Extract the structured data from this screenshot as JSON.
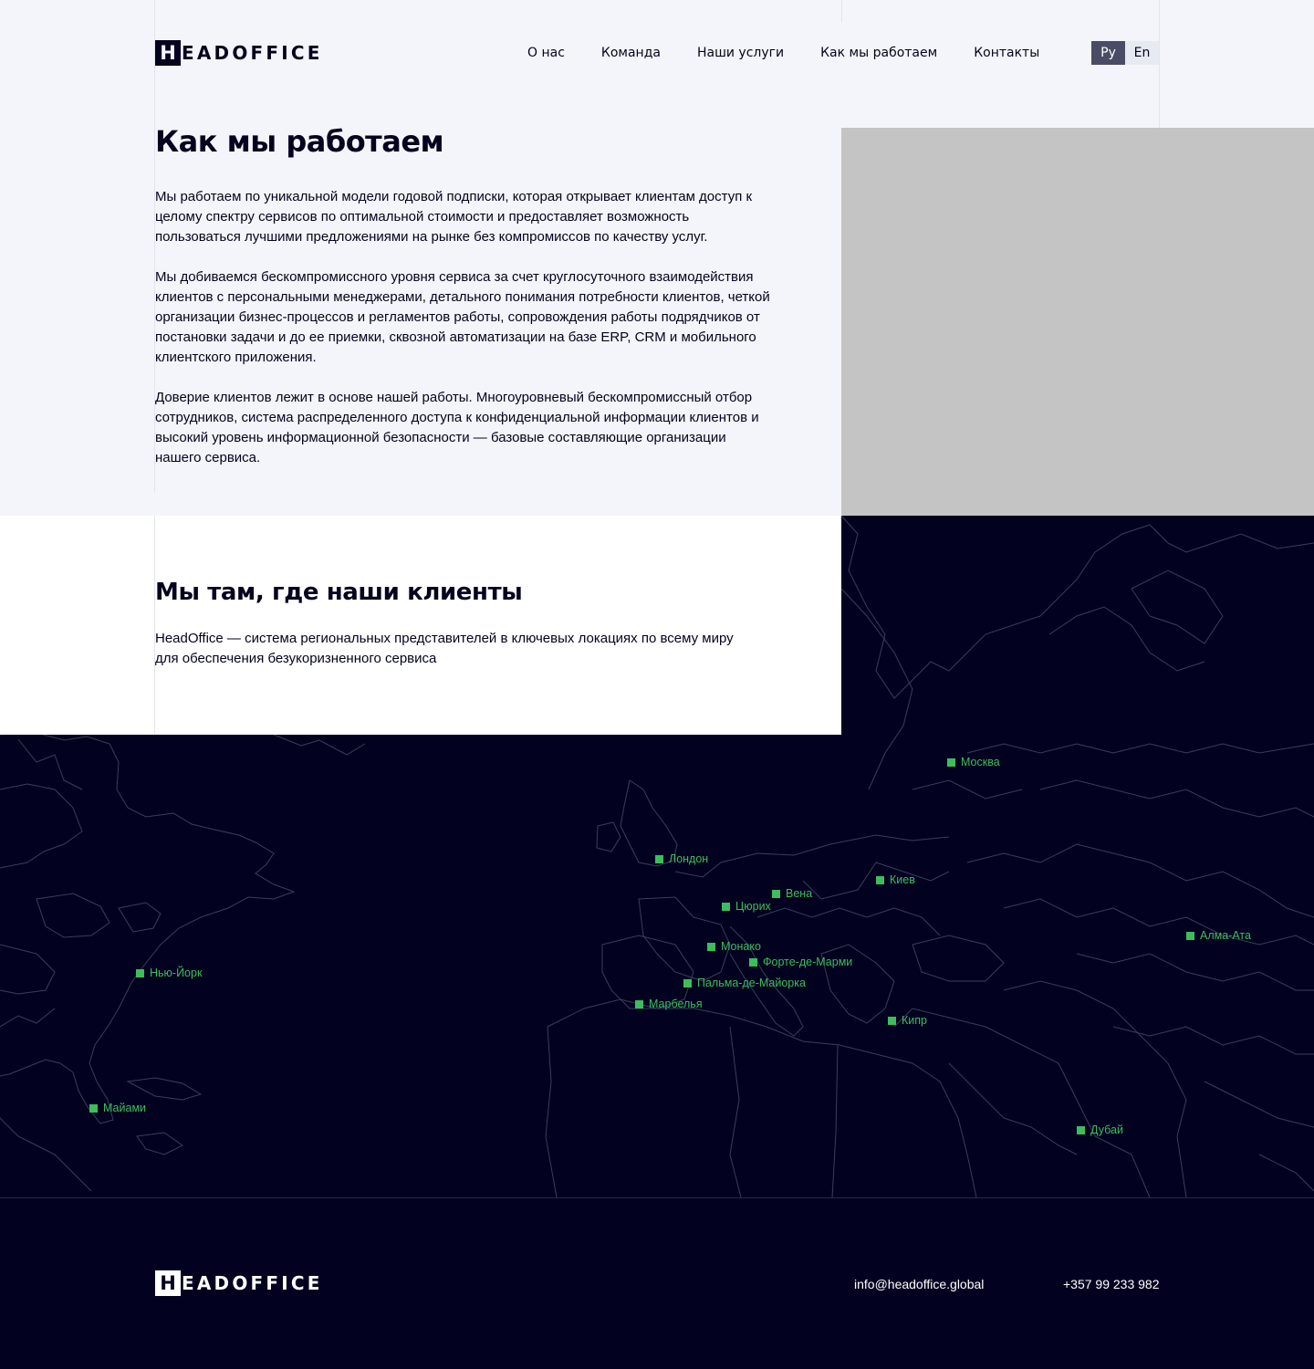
{
  "brand": {
    "letter": "H",
    "rest": "EADOFFICE"
  },
  "nav": {
    "items": [
      "О нас",
      "Команда",
      "Наши услуги",
      "Как мы работаем",
      "Контакты"
    ]
  },
  "lang": {
    "active": "Ру",
    "inactive": "En"
  },
  "hero": {
    "title": "Как мы работаем",
    "paragraphs": [
      "Мы работаем по уникальной модели годовой подписки, которая открывает клиентам доступ к целому спектру сервисов по оптимальной стоимости и предоставляет возможность пользоваться лучшими предложениями на рынке без компромиссов по качеству услуг.",
      "Мы добиваемся бескомпромиссного уровня сервиса за счет круглосуточного взаимодействия клиентов с персональными менеджерами, детального понимания потребности клиентов, четкой организации бизнес-процессов и регламентов работы, сопровождения работы подрядчиков от постановки задачи и до ее приемки, сквозной автоматизации на базе ERP, CRM и мобильного клиентского приложения.",
      "Доверие клиентов лежит в основе нашей работы. Многоуровневый бескомпромиссный отбор сотрудников, система распределенного доступа к конфиденциальной информации клиентов и высокий уровень информационной безопасности — базовые составляющие организации нашего сервиса."
    ]
  },
  "locations": {
    "title": "Мы там, где наши клиенты",
    "text": "HeadOffice — система региональных представителей в ключевых локациях по всему миру для обеспечения безукоризненного сервиса",
    "cities": [
      "Москва",
      "Лондон",
      "Вена",
      "Киев",
      "Цюрих",
      "Монако",
      "Форте-де-Марми",
      "Пальма-де-Майорка",
      "Марбелья",
      "Кипр",
      "Алма-Ата",
      "Нью-Йорк",
      "Майами",
      "Дубай"
    ],
    "marker_color": "#3dbd5b"
  },
  "footer": {
    "email": "info@headoffice.global",
    "phone": "+357 99 233 982"
  },
  "colors": {
    "dark": "#020220",
    "light_bg": "#f4f5fa",
    "image_placeholder": "#c4c4c4",
    "accent_green": "#3dbd5b"
  }
}
